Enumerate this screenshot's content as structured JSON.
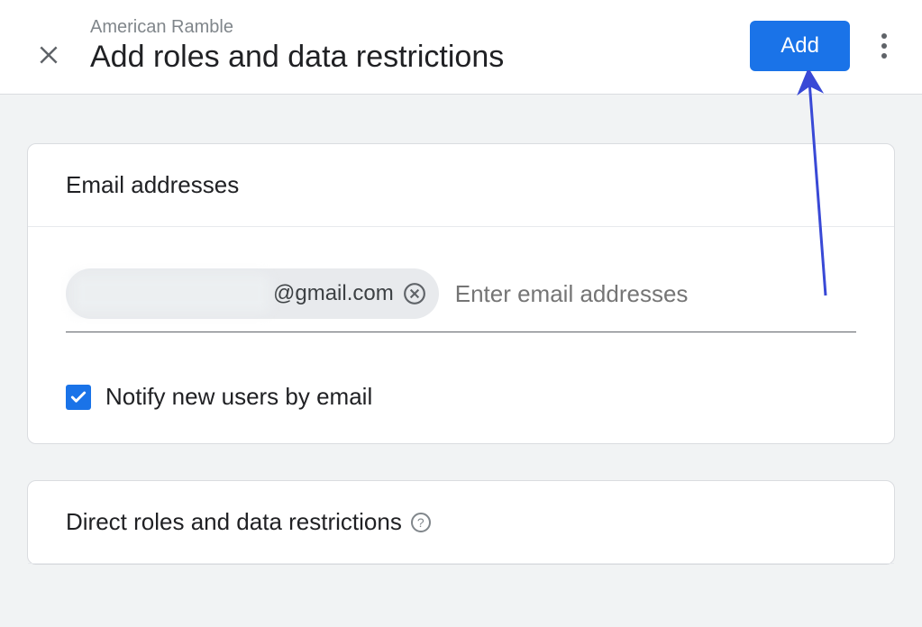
{
  "header": {
    "breadcrumb": "American Ramble",
    "title": "Add roles and data restrictions",
    "add_button_label": "Add"
  },
  "email_card": {
    "header": "Email addresses",
    "chip_domain": "@gmail.com",
    "placeholder": "Enter email addresses",
    "notify_checkbox_label": "Notify new users by email",
    "notify_checked": true
  },
  "roles_card": {
    "header": "Direct roles and data restrictions"
  }
}
